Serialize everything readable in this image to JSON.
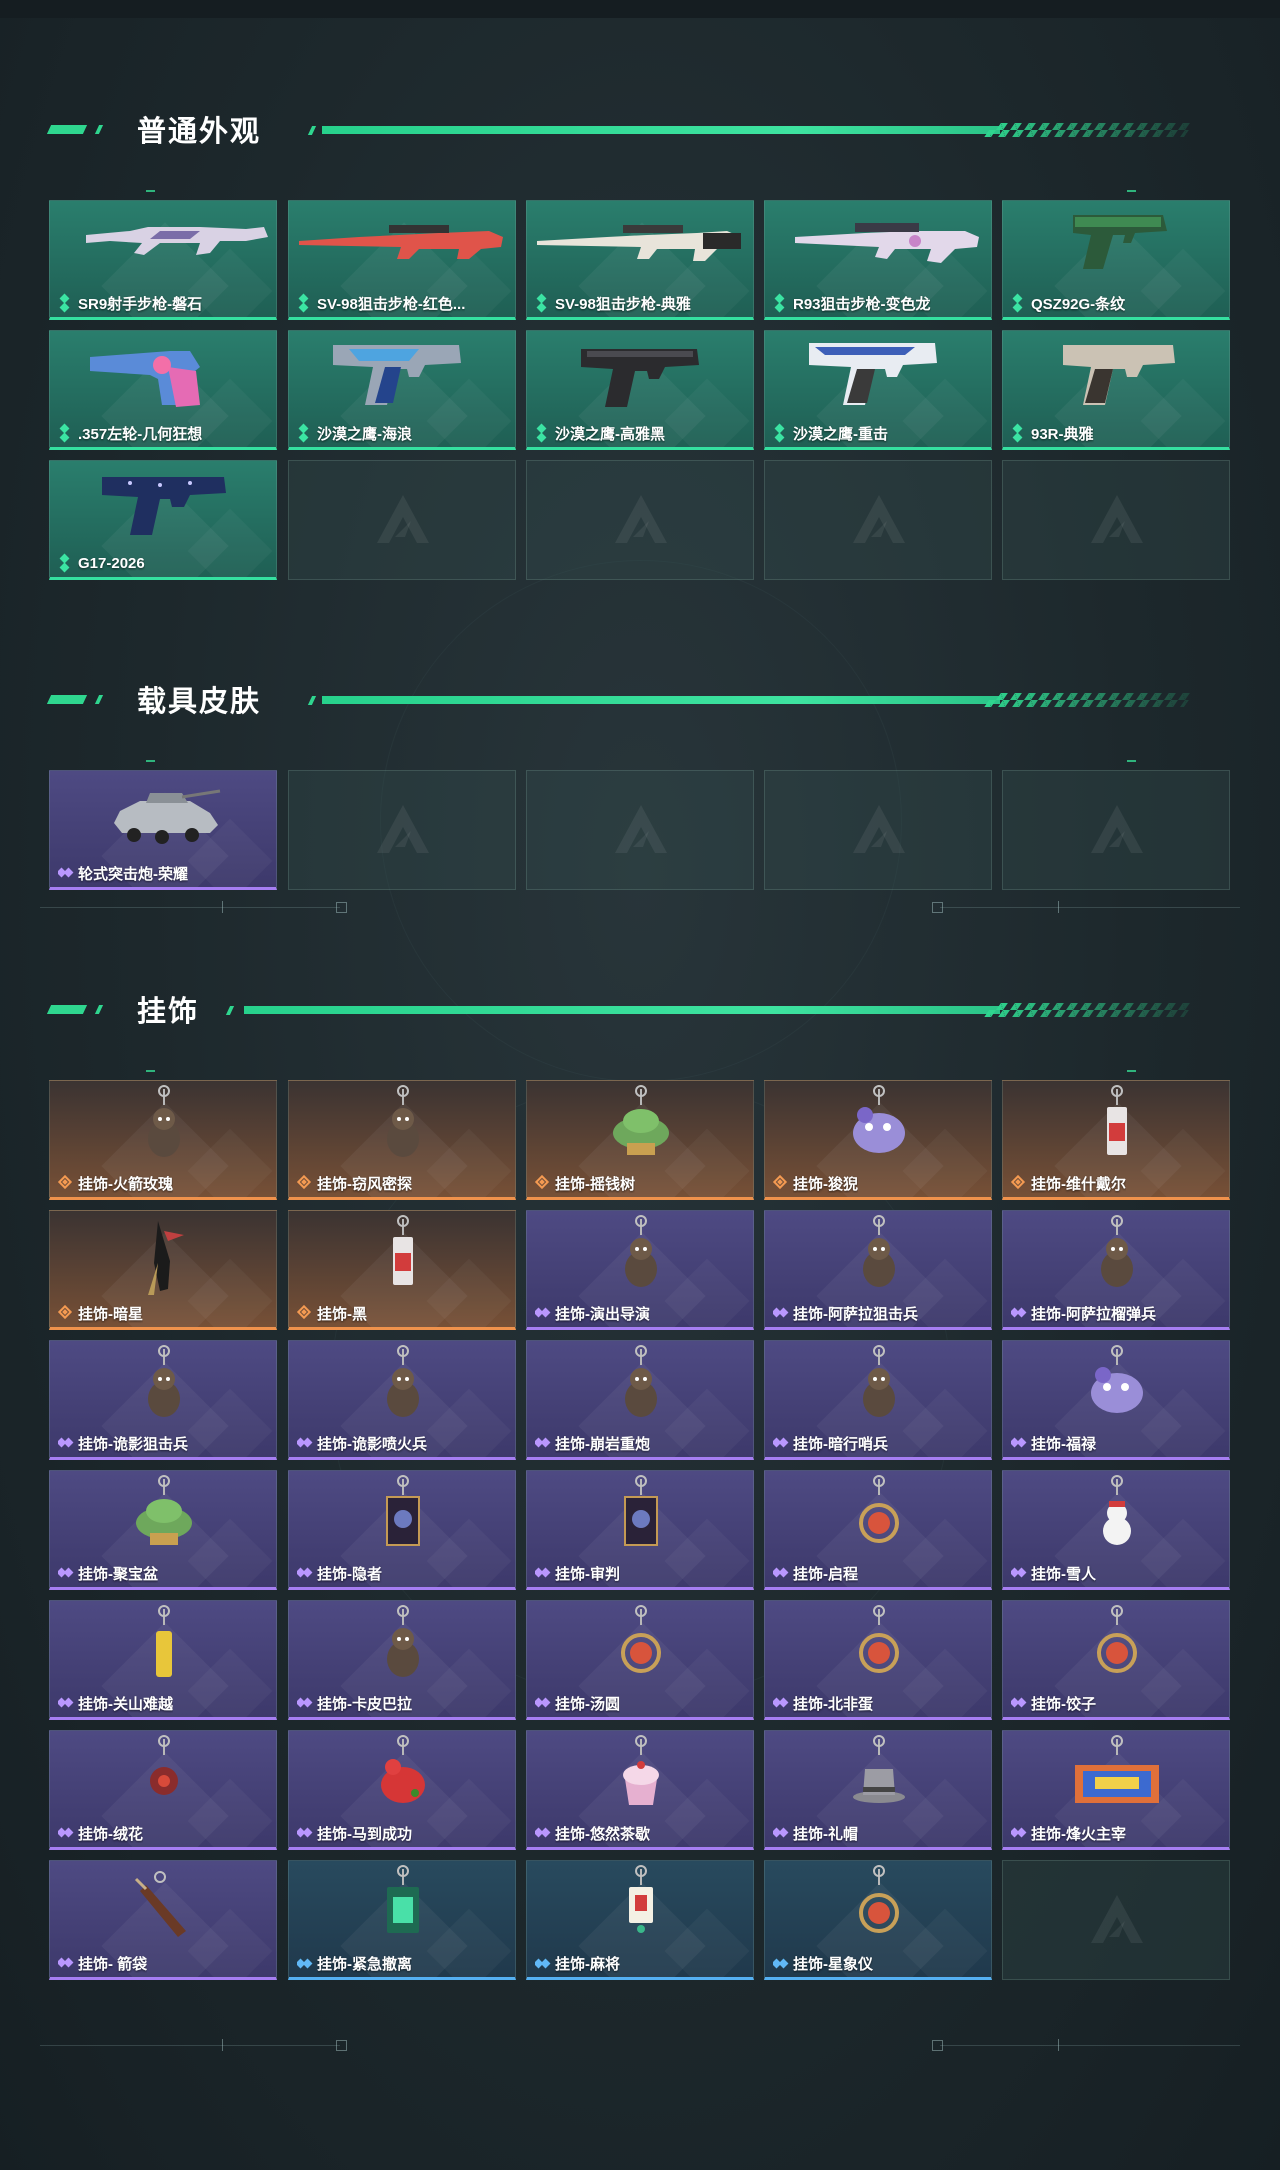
{
  "sections": [
    {
      "title": "普通外观",
      "items": [
        {
          "name": "SR9射手步枪-磐石",
          "rarity": "green",
          "art": "rifle"
        },
        {
          "name": "SV-98狙击步枪-红色...",
          "rarity": "green",
          "art": "sniper-red"
        },
        {
          "name": "SV-98狙击步枪-典雅",
          "rarity": "green",
          "art": "sniper-white"
        },
        {
          "name": "R93狙击步枪-变色龙",
          "rarity": "green",
          "art": "sniper-pink"
        },
        {
          "name": "QSZ92G-条纹",
          "rarity": "green",
          "art": "pistol-green"
        },
        {
          "name": ".357左轮-几何狂想",
          "rarity": "green",
          "art": "revolver"
        },
        {
          "name": "沙漠之鹰-海浪",
          "rarity": "green",
          "art": "deagle-blue"
        },
        {
          "name": "沙漠之鹰-高雅黑",
          "rarity": "green",
          "art": "deagle-black"
        },
        {
          "name": "沙漠之鹰-重击",
          "rarity": "green",
          "art": "deagle-white"
        },
        {
          "name": "93R-典雅",
          "rarity": "green",
          "art": "pistol-beige"
        },
        {
          "name": "G17-2026",
          "rarity": "green",
          "art": "glock"
        }
      ]
    },
    {
      "title": "载具皮肤",
      "items": [
        {
          "name": "轮式突击炮-荣耀",
          "rarity": "purple",
          "art": "vehicle"
        }
      ]
    },
    {
      "title": "挂饰",
      "items": [
        {
          "name": "挂饰-火箭玫瑰",
          "rarity": "orange",
          "art": "charm"
        },
        {
          "name": "挂饰-窃风密探",
          "rarity": "orange",
          "art": "charm"
        },
        {
          "name": "挂饰-摇钱树",
          "rarity": "orange",
          "art": "charm-tree"
        },
        {
          "name": "挂饰-狻猊",
          "rarity": "orange",
          "art": "charm-beast"
        },
        {
          "name": "挂饰-维什戴尔",
          "rarity": "orange",
          "art": "charm-tag"
        },
        {
          "name": "挂饰-暗星",
          "rarity": "orange",
          "art": "charm-bird"
        },
        {
          "name": "挂饰-黑",
          "rarity": "orange",
          "art": "charm-tag"
        },
        {
          "name": "挂饰-演出导演",
          "rarity": "purple",
          "art": "charm-figure"
        },
        {
          "name": "挂饰-阿萨拉狙击兵",
          "rarity": "purple",
          "art": "charm-figure"
        },
        {
          "name": "挂饰-阿萨拉榴弹兵",
          "rarity": "purple",
          "art": "charm-figure"
        },
        {
          "name": "挂饰-诡影狙击兵",
          "rarity": "purple",
          "art": "charm-figure"
        },
        {
          "name": "挂饰-诡影喷火兵",
          "rarity": "purple",
          "art": "charm-figure"
        },
        {
          "name": "挂饰-崩岩重炮",
          "rarity": "purple",
          "art": "charm-figure"
        },
        {
          "name": "挂饰-暗行哨兵",
          "rarity": "purple",
          "art": "charm-figure"
        },
        {
          "name": "挂饰-福禄",
          "rarity": "purple",
          "art": "charm-beast"
        },
        {
          "name": "挂饰-聚宝盆",
          "rarity": "purple",
          "art": "charm-tree"
        },
        {
          "name": "挂饰-隐者",
          "rarity": "purple",
          "art": "charm-card"
        },
        {
          "name": "挂饰-审判",
          "rarity": "purple",
          "art": "charm-card"
        },
        {
          "name": "挂饰-启程",
          "rarity": "purple",
          "art": "charm-ring"
        },
        {
          "name": "挂饰-雪人",
          "rarity": "purple",
          "art": "charm-snow"
        },
        {
          "name": "挂饰-关山难越",
          "rarity": "purple",
          "art": "charm-yellow"
        },
        {
          "name": "挂饰-卡皮巴拉",
          "rarity": "purple",
          "art": "charm-figure"
        },
        {
          "name": "挂饰-汤圆",
          "rarity": "purple",
          "art": "charm-ring"
        },
        {
          "name": "挂饰-北非蛋",
          "rarity": "purple",
          "art": "charm-ring"
        },
        {
          "name": "挂饰-饺子",
          "rarity": "purple",
          "art": "charm-ring"
        },
        {
          "name": "挂饰-绒花",
          "rarity": "purple",
          "art": "charm-flower"
        },
        {
          "name": "挂饰-马到成功",
          "rarity": "purple",
          "art": "charm-red"
        },
        {
          "name": "挂饰-悠然茶歇",
          "rarity": "purple",
          "art": "charm-cake"
        },
        {
          "name": "挂饰-礼帽",
          "rarity": "purple",
          "art": "charm-hat"
        },
        {
          "name": "挂饰-烽火主宰",
          "rarity": "purple",
          "art": "charm-banner"
        },
        {
          "name": "挂饰- 箭袋",
          "rarity": "purple",
          "art": "charm-quiver"
        },
        {
          "name": "挂饰-紧急撤离",
          "rarity": "blue",
          "art": "charm-tag-green"
        },
        {
          "name": "挂饰-麻将",
          "rarity": "blue",
          "art": "charm-tile"
        },
        {
          "name": "挂饰-星象仪",
          "rarity": "blue",
          "art": "charm-ring"
        }
      ]
    }
  ],
  "colors": {
    "accent": "#2fd68f",
    "green_card": "#23695c",
    "purple_card": "#46427a",
    "orange_card": "#6a4733",
    "blue_card": "#244357"
  }
}
